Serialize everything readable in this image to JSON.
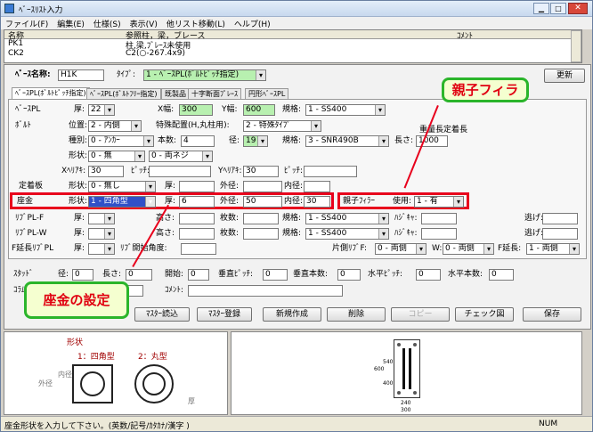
{
  "window": {
    "title": "ﾍﾞｰｽﾘｽﾄ入力",
    "update_label": "更新"
  },
  "menu": [
    "ファイル(F)",
    "編集(E)",
    "仕様(S)",
    "表示(V)",
    "他リスト移動(L)",
    "ヘルプ(H)"
  ],
  "list": {
    "headers": [
      "名称",
      "参照柱，梁，ブレース",
      "ｺﾒﾝﾄ"
    ],
    "rows": [
      [
        "PK1",
        "柱,梁,ﾌﾞﾚｰｽ未使用",
        ""
      ],
      [
        "CK2",
        "C2(○-267.4x9)",
        ""
      ]
    ]
  },
  "top": {
    "name_label": "ﾍﾞｰｽ名称:",
    "name_value": "H1K",
    "type_label": "ﾀｲﾌﾟ:",
    "type_value": "1 - ﾍﾞｰｽPL(ﾎﾞﾙﾄﾋﾟｯﾁ指定)"
  },
  "tabs": [
    "ﾍﾞｰｽPL(ﾎﾞﾙﾄﾋﾟｯﾁ指定)",
    "ﾍﾞｰｽPL(ﾎﾞﾙﾄﾌﾘｰ指定)",
    "既製品",
    "十字断面ﾌﾟﾚｰｽ",
    "円形ﾍﾞｰｽPL"
  ],
  "base_pl": {
    "label": "ﾍﾞｰｽPL",
    "thick_label": "厚:",
    "thick": "22",
    "xw_label": "X幅:",
    "xw": "300",
    "yw_label": "Y幅:",
    "yw": "600",
    "spec_label": "規格:",
    "spec": "1 - SS400"
  },
  "bolt": {
    "label": "ﾎﾞﾙﾄ",
    "pos_label": "位置:",
    "pos": "2 - 内側",
    "special_label": "特殊配置(H,丸柱用):",
    "special": "2 - 特殊ﾀｲﾌﾟ",
    "kind_label": "種別:",
    "kind": "0 - ｱﾝｶｰ",
    "count_label": "本数:",
    "count": "4",
    "dia_label": "径:",
    "dia": "19",
    "spec_label": "規格:",
    "spec": "3 - SNR490B",
    "len_label": "長さ:",
    "len": "1000",
    "fixlen_label": "重量長定着長",
    "shape_label": "形状:",
    "shape1": "0 - 無",
    "shape2": "0 - 両ネジ",
    "xh_label": "Xﾍﾘｱｷ:",
    "xh": "30",
    "xp_label": "ﾋﾟｯﾁ:",
    "xp": "",
    "yh_label": "Yﾍﾘｱｷ:",
    "yh": "30",
    "yp_label": "ﾋﾟｯﾁ:",
    "yp": ""
  },
  "anchor": {
    "label": "定着板",
    "shape_label": "形状:",
    "shape": "0 - 無し",
    "thick_label": "厚:",
    "thick": "",
    "od_label": "外径:",
    "od": "",
    "id_label": "内径:",
    "id": ""
  },
  "washer": {
    "label": "座金",
    "shape_label": "形状:",
    "shape": "1 - 四角型",
    "thick_label": "厚:",
    "thick": "6",
    "od_label": "外径:",
    "od": "50",
    "id_label": "内径:",
    "id": "30"
  },
  "filler": {
    "label": "親子ﾌｨﾗｰ",
    "use_label": "使用:",
    "use": "1 - 有"
  },
  "rib_f": {
    "label": "ﾘﾌﾞPL-F",
    "thick_label": "厚:",
    "h_label": "高さ:",
    "n_label": "枚数:",
    "spec_label": "規格:",
    "spec": "1 - SS400",
    "hw_label": "ﾊｼﾞｷｬ:",
    "tk_label": "逃げ:"
  },
  "rib_w": {
    "label": "ﾘﾌﾞPL-W",
    "thick_label": "厚:",
    "h_label": "高さ:",
    "n_label": "枚数:",
    "spec_label": "規格:",
    "spec": "1 - SS400",
    "hw_label": "ﾊｼﾞｷｬ:",
    "tk_label": "逃げ:"
  },
  "fext": {
    "label": "F延長ﾘﾌﾞPL",
    "thick_label": "厚:",
    "angle_label": "ﾘﾌﾞ開始角度:",
    "side_label": "片側ﾘﾌﾞF:",
    "side": "0 - 両側",
    "w_label": "W:",
    "w": "0 - 両側",
    "fext_label": "F延長:",
    "fext": "1 - 両側"
  },
  "stud": {
    "label": "ｽﾀｯﾄﾞ",
    "dia_label": "径:",
    "dia": "0",
    "len_label": "長さ:",
    "len": "0",
    "start_label": "開始:",
    "start": "0",
    "vp_label": "垂直ﾋﾟｯﾁ:",
    "vp": "0",
    "vn_label": "垂直本数:",
    "vn": "0",
    "hp_label": "水平ﾋﾟｯﾁ:",
    "hp": "0",
    "hn_label": "水平本数:",
    "hn": "0"
  },
  "column": {
    "label": "ｺﾗﾑ",
    "comment_label": "ｺﾒﾝﾄ:"
  },
  "buttons": [
    "ﾏｽﾀｰ読込",
    "ﾏｽﾀｰ登録",
    "新規作成",
    "削除",
    "コピー",
    "チェック図",
    "保存"
  ],
  "preview_left": {
    "title": "形状",
    "opt1": "1：四角型",
    "opt2": "2：丸型",
    "outer": "外径",
    "inner": "内径",
    "thick": "厚"
  },
  "preview_right": {
    "d1": "600",
    "d2": "540",
    "d3": "400",
    "w1": "240",
    "w2": "300"
  },
  "status": {
    "message": "座金形状を入力して下さい。(英数/記号/ｶﾀｶﾅ/漢字 )",
    "num": "NUM"
  },
  "callouts": {
    "filler": "親子フィラ",
    "washer": "座金の設定"
  },
  "colors": {
    "callout_border": "#2bb52b",
    "callout_text": "#e00010",
    "highlight": "#e8001c"
  }
}
